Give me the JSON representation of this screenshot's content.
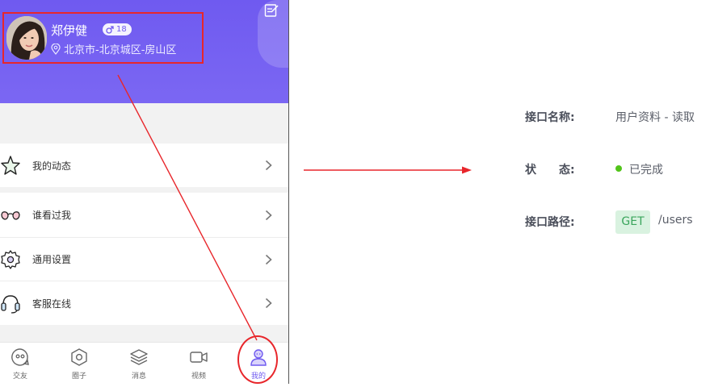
{
  "profile": {
    "name": "郑伊健",
    "level": "18",
    "location": "北京市-北京城区-房山区"
  },
  "menu": [
    {
      "label": "我的动态",
      "icon": "star-icon"
    },
    {
      "label": "谁看过我",
      "icon": "glasses-icon"
    },
    {
      "label": "通用设置",
      "icon": "settings-icon"
    },
    {
      "label": "客服在线",
      "icon": "headset-icon"
    }
  ],
  "nav": [
    {
      "label": "交友",
      "icon": "chat-face-icon"
    },
    {
      "label": "圈子",
      "icon": "hexagon-icon"
    },
    {
      "label": "消息",
      "icon": "layers-icon"
    },
    {
      "label": "视频",
      "icon": "video-camera-icon"
    },
    {
      "label": "我的",
      "icon": "user-profile-icon",
      "active": true
    }
  ],
  "api_info": {
    "name_label": "接口名称:",
    "name_value": "用户资料 - 读取",
    "status_label": "状　　态:",
    "status_value": "已完成",
    "path_label": "接口路径:",
    "method": "GET",
    "path": "/users"
  },
  "colors": {
    "brand": "#6f5af0",
    "annotation": "#e8262b",
    "status_done": "#52c41a",
    "method_bg": "#d9f2e0",
    "method_text": "#3aa55c"
  }
}
